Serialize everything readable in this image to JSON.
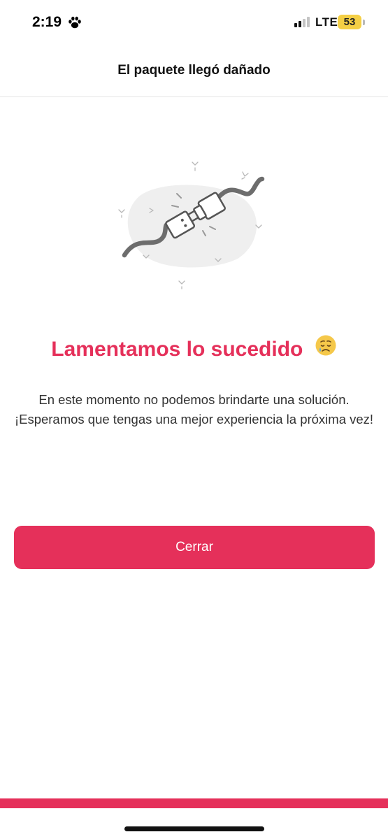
{
  "status_bar": {
    "time": "2:19",
    "network": "LTE",
    "battery": "53",
    "icons": [
      "paw-icon",
      "signal-icon"
    ]
  },
  "header": {
    "title": "El paquete llegó dañado"
  },
  "illustration": {
    "icon": "unplugged-cable-icon"
  },
  "content": {
    "heading": "Lamentamos lo sucedido",
    "heading_emoji": "sad-face-icon",
    "message": "En este momento no podemos brindarte una solución. ¡Esperamos que tengas una mejor experiencia la próxima vez!"
  },
  "actions": {
    "close_label": "Cerrar"
  },
  "colors": {
    "accent": "#e5305a",
    "battery": "#f4cf45"
  }
}
